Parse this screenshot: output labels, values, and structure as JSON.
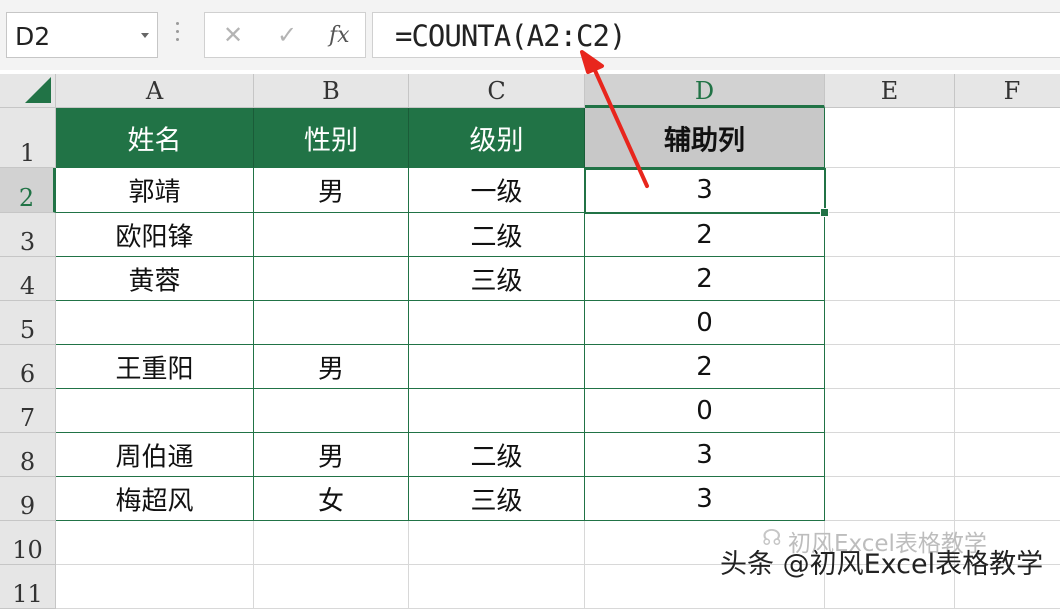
{
  "formula_bar": {
    "name_box": "D2",
    "cancel_icon": "✕",
    "enter_icon": "✓",
    "fx_label": "fx",
    "formula": "=COUNTA(A2:C2)"
  },
  "columns": [
    "A",
    "B",
    "C",
    "D",
    "E",
    "F"
  ],
  "rows": [
    "1",
    "2",
    "3",
    "4",
    "5",
    "6",
    "7",
    "8",
    "9",
    "10",
    "11"
  ],
  "table": {
    "headers": [
      "姓名",
      "性别",
      "级别",
      "辅助列"
    ],
    "rows": [
      [
        "郭靖",
        "男",
        "一级",
        "3"
      ],
      [
        "欧阳锋",
        "",
        "二级",
        "2"
      ],
      [
        "黄蓉",
        "",
        "三级",
        "2"
      ],
      [
        "",
        "",
        "",
        "0"
      ],
      [
        "王重阳",
        "男",
        "",
        "2"
      ],
      [
        "",
        "",
        "",
        "0"
      ],
      [
        "周伯通",
        "男",
        "二级",
        "3"
      ],
      [
        "梅超风",
        "女",
        "三级",
        "3"
      ]
    ]
  },
  "watermark": {
    "faint": "初风Excel表格教学",
    "main": "头条 @初风Excel表格教学"
  },
  "colors": {
    "excel_green": "#217346",
    "arrow_red": "#e8261d",
    "header_gray": "#c8c8c8"
  }
}
